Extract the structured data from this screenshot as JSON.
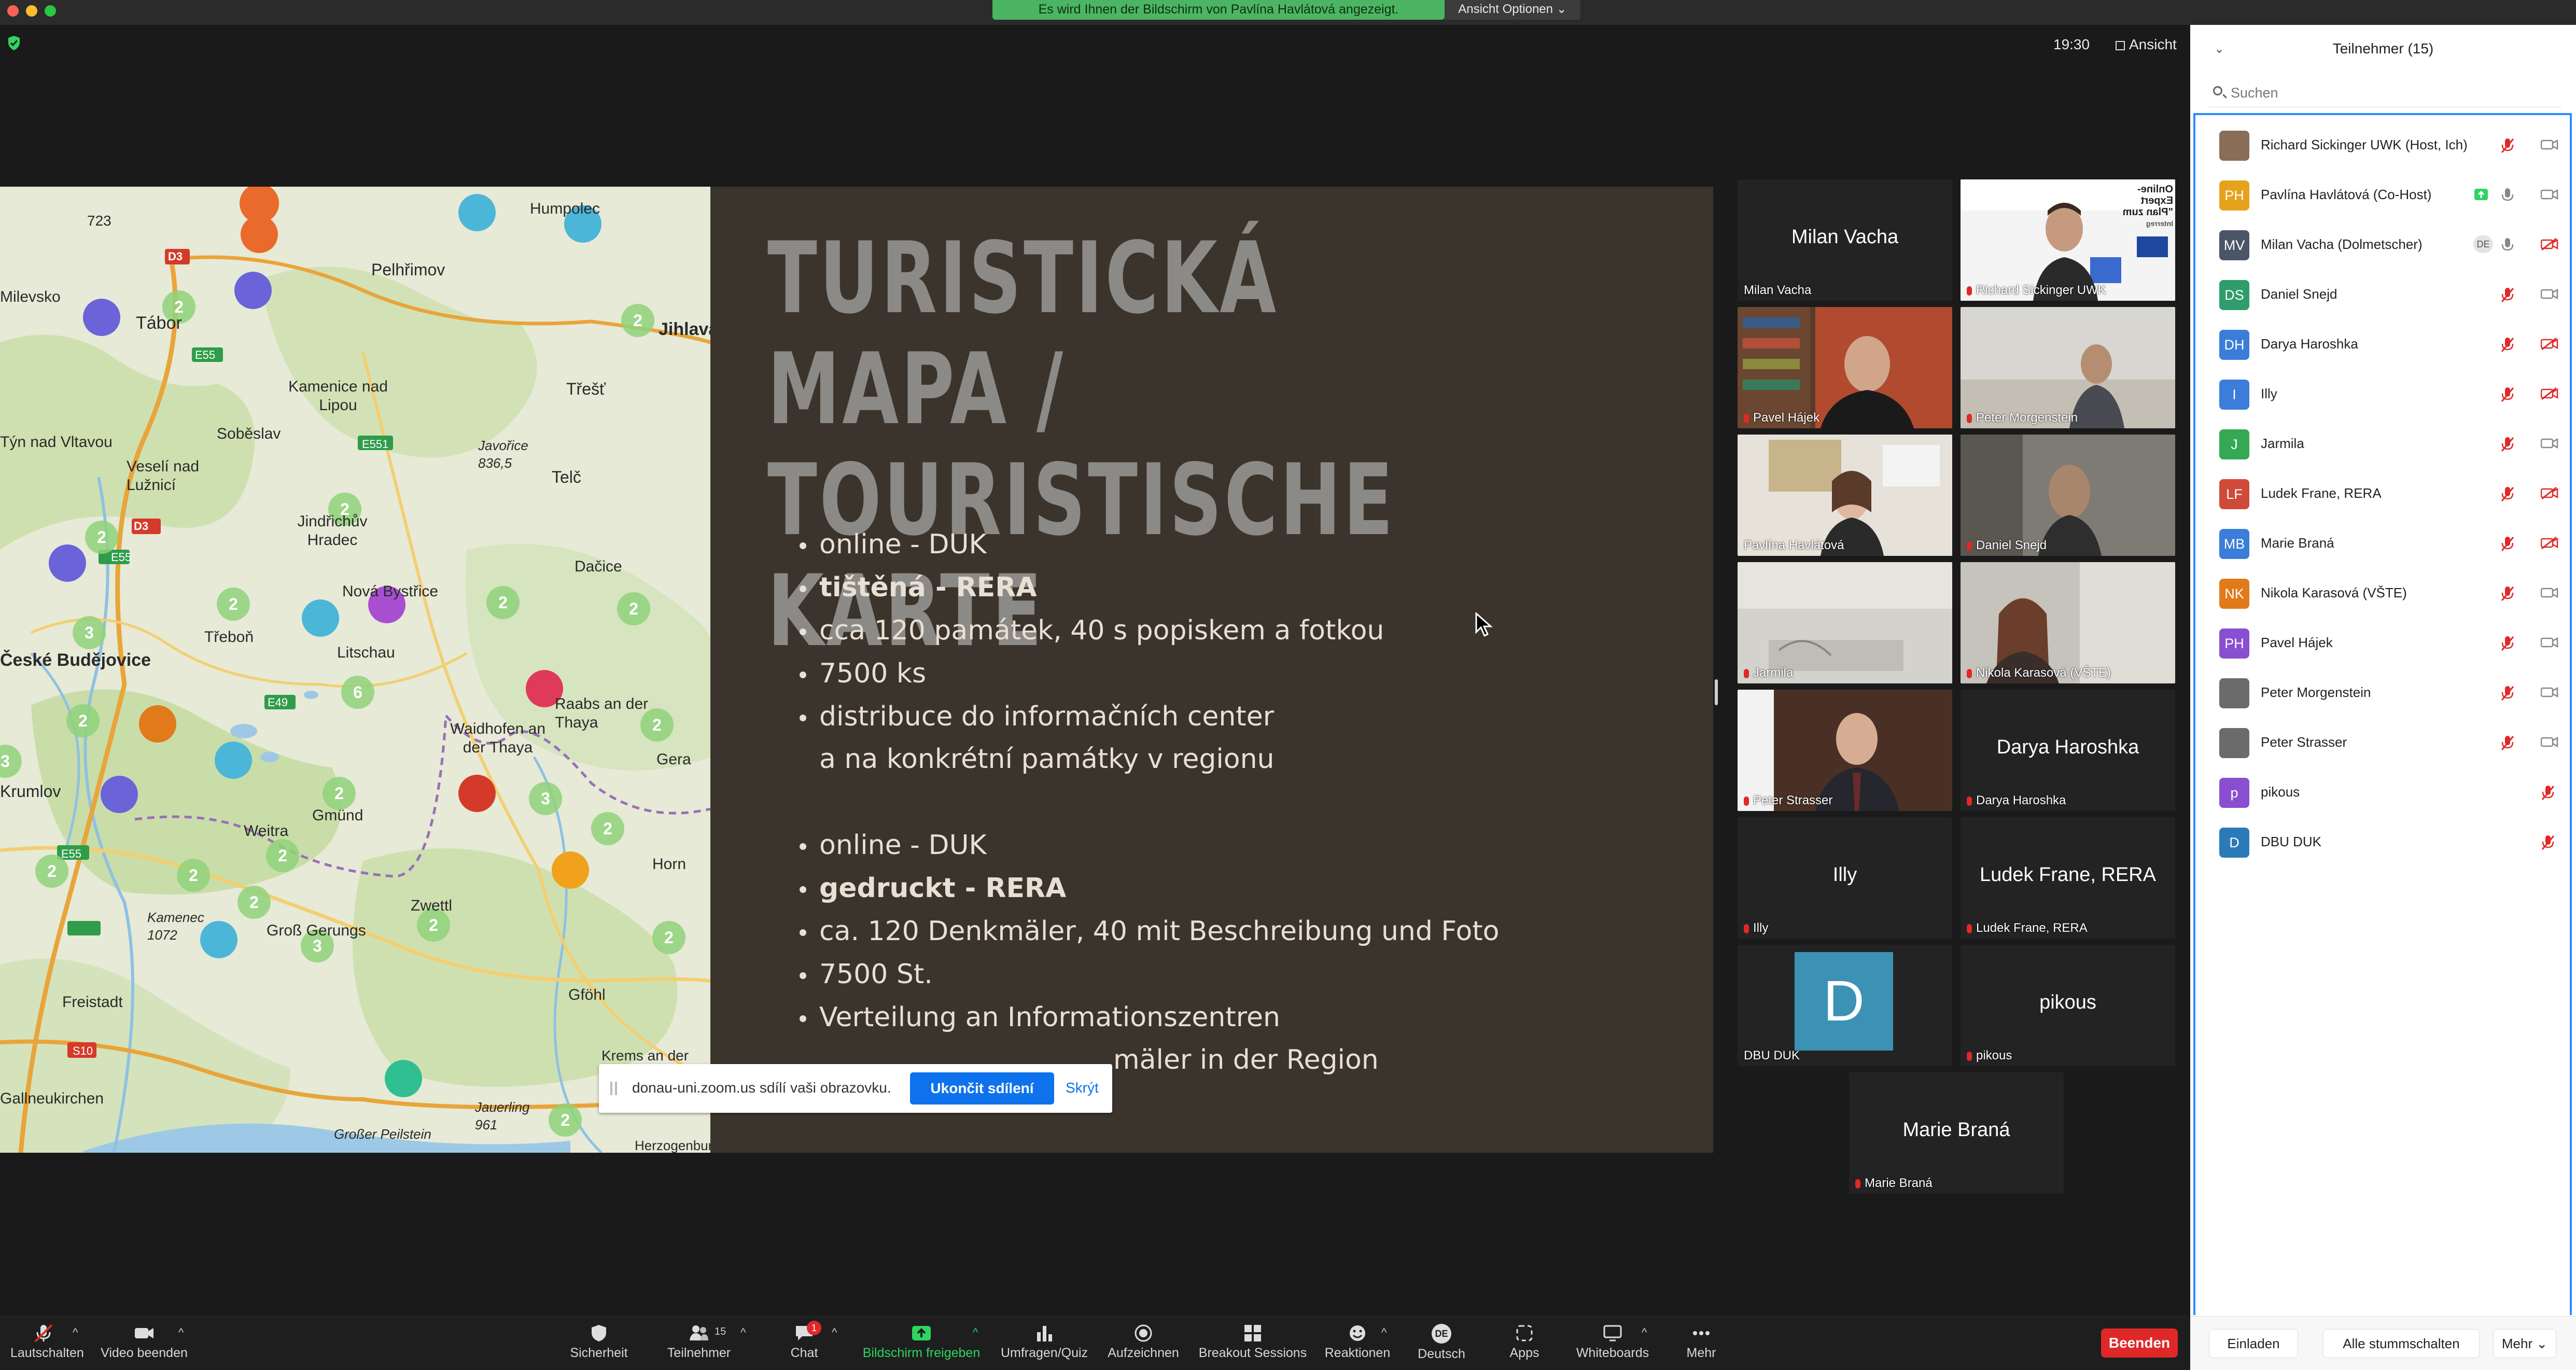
{
  "window": {
    "share_banner": "Es wird Ihnen der Bildschirm von Pavlína Havlátová angezeigt.",
    "view_options": "Ansicht Optionen",
    "clock": "19:30",
    "view_label": "Ansicht"
  },
  "shared": {
    "map_labels": [
      "723",
      "D3",
      "Pelhřimov",
      "Milevsko",
      "Tábor",
      "E55",
      "Humpolec",
      "Jihlava",
      "Kamenice nad Lipou",
      "Třešť",
      "Týn nad Vltavou",
      "Soběslav",
      "Veselí nad Lužnicí",
      "E551",
      "Javořice 836,5",
      "Telč",
      "D3",
      "Jindřichův Hradec",
      "E55",
      "Nová Bystřice",
      "Dačice",
      "Třeboň",
      "Litschau",
      "České Budějovice",
      "E49",
      "Raabs an der Thaya",
      "Waidhofen an der Thaya",
      "Gera",
      "Krumlov",
      "Weitra",
      "Gmünd",
      "E55",
      "Zwettl",
      "Horn",
      "Kamenec 1072",
      "Groß Gerungs",
      "Freistadt",
      "Gföhl",
      "S10",
      "Krems an der Donau",
      "Gallneukirchen",
      "Großer Peilstein",
      "Jauerling 961",
      "Herzogenburg"
    ],
    "slide_title_line1": "TURISTICKÁ MAPA /",
    "slide_title_line2": "TOURISTISCHE KARTE",
    "bullets": [
      "online - DUK",
      "tištěná - RERA",
      "cca 120 památek, 40 s popiskem a fotkou",
      "7500 ks",
      "distribuce do informačních center",
      "a na konkrétní památky v regionu",
      "online - DUK",
      "gedruckt - RERA",
      "ca. 120 Denkmäler, 40 mit Beschreibung und Foto",
      "7500 St.",
      "Verteilung an Informationszentren",
      "mäler in der Region"
    ],
    "popup_msg": "donau-uni.zoom.us sdílí vaši obrazovku.",
    "popup_stop": "Ukončit sdílení",
    "popup_hide": "Skrýt"
  },
  "gallery": [
    {
      "big": "Milan Vacha",
      "name": "Milan Vacha"
    },
    {
      "big": "",
      "name": "Richard Sickinger UWK"
    },
    {
      "big": "",
      "name": "Pavel Hájek"
    },
    {
      "big": "",
      "name": "Peter Morgenstein"
    },
    {
      "big": "",
      "name": "Pavlína Havlátová"
    },
    {
      "big": "",
      "name": "Daniel Snejd"
    },
    {
      "big": "",
      "name": "Jarmila"
    },
    {
      "big": "",
      "name": "Nikola Karasová (VŠTE)"
    },
    {
      "big": "",
      "name": "Peter Strasser"
    },
    {
      "big": "Darya Haroshka",
      "name": "Darya Haroshka"
    },
    {
      "big": "Illy",
      "name": "Illy"
    },
    {
      "big": "Ludek Frane, RERA",
      "name": "Ludek Frane, RERA"
    },
    {
      "big": "D",
      "name": "DBU DUK"
    },
    {
      "big": "pikous",
      "name": "pikous"
    },
    {
      "big": "Marie Braná",
      "name": "Marie Braná"
    }
  ],
  "slide_thumb_text": [
    "Online-Expert",
    "\"Plan zum",
    "Interreg"
  ],
  "toolbar": {
    "mute": "Lautschalten",
    "video": "Video beenden",
    "security": "Sicherheit",
    "participants": "Teilnehmer",
    "participants_count": "15",
    "chat": "Chat",
    "chat_badge": "1",
    "share": "Bildschirm freigeben",
    "polls": "Umfragen/Quiz",
    "record": "Aufzeichnen",
    "breakout": "Breakout Sessions",
    "reactions": "Reaktionen",
    "language": "Deutsch",
    "language_badge": "DE",
    "apps": "Apps",
    "whiteboards": "Whiteboards",
    "more": "Mehr",
    "end": "Beenden"
  },
  "panel": {
    "title": "Teilnehmer (15)",
    "search_placeholder": "Suchen",
    "invite": "Einladen",
    "mute_all": "Alle stummschalten",
    "more": "Mehr",
    "participants": [
      {
        "initials": "",
        "name": "Richard Sickinger UWK (Host, Ich)",
        "color": "#8a6d57"
      },
      {
        "initials": "PH",
        "name": "Pavlína Havlátová (Co-Host)",
        "color": "#e5a21c"
      },
      {
        "initials": "MV",
        "name": "Milan Vacha (Dolmetscher)",
        "color": "#4a5568"
      },
      {
        "initials": "DS",
        "name": "Daniel Snejd",
        "color": "#2f9c6b"
      },
      {
        "initials": "DH",
        "name": "Darya Haroshka",
        "color": "#3b7dd8"
      },
      {
        "initials": "I",
        "name": "Illy",
        "color": "#3b7dd8"
      },
      {
        "initials": "J",
        "name": "Jarmila",
        "color": "#34a853"
      },
      {
        "initials": "LF",
        "name": "Ludek Frane, RERA",
        "color": "#d04a3a"
      },
      {
        "initials": "MB",
        "name": "Marie Braná",
        "color": "#3b7dd8"
      },
      {
        "initials": "NK",
        "name": "Nikola Karasová (VŠTE)",
        "color": "#e07a1b"
      },
      {
        "initials": "PH",
        "name": "Pavel Hájek",
        "color": "#8a4fd0"
      },
      {
        "initials": "",
        "name": "Peter Morgenstein",
        "color": "#6b6b6b"
      },
      {
        "initials": "",
        "name": "Peter Strasser",
        "color": "#6b6b6b"
      },
      {
        "initials": "p",
        "name": "pikous",
        "color": "#8a4fd0"
      },
      {
        "initials": "D",
        "name": "DBU DUK",
        "color": "#2b7bb9"
      }
    ],
    "dolmetscher_badge": "DE"
  }
}
